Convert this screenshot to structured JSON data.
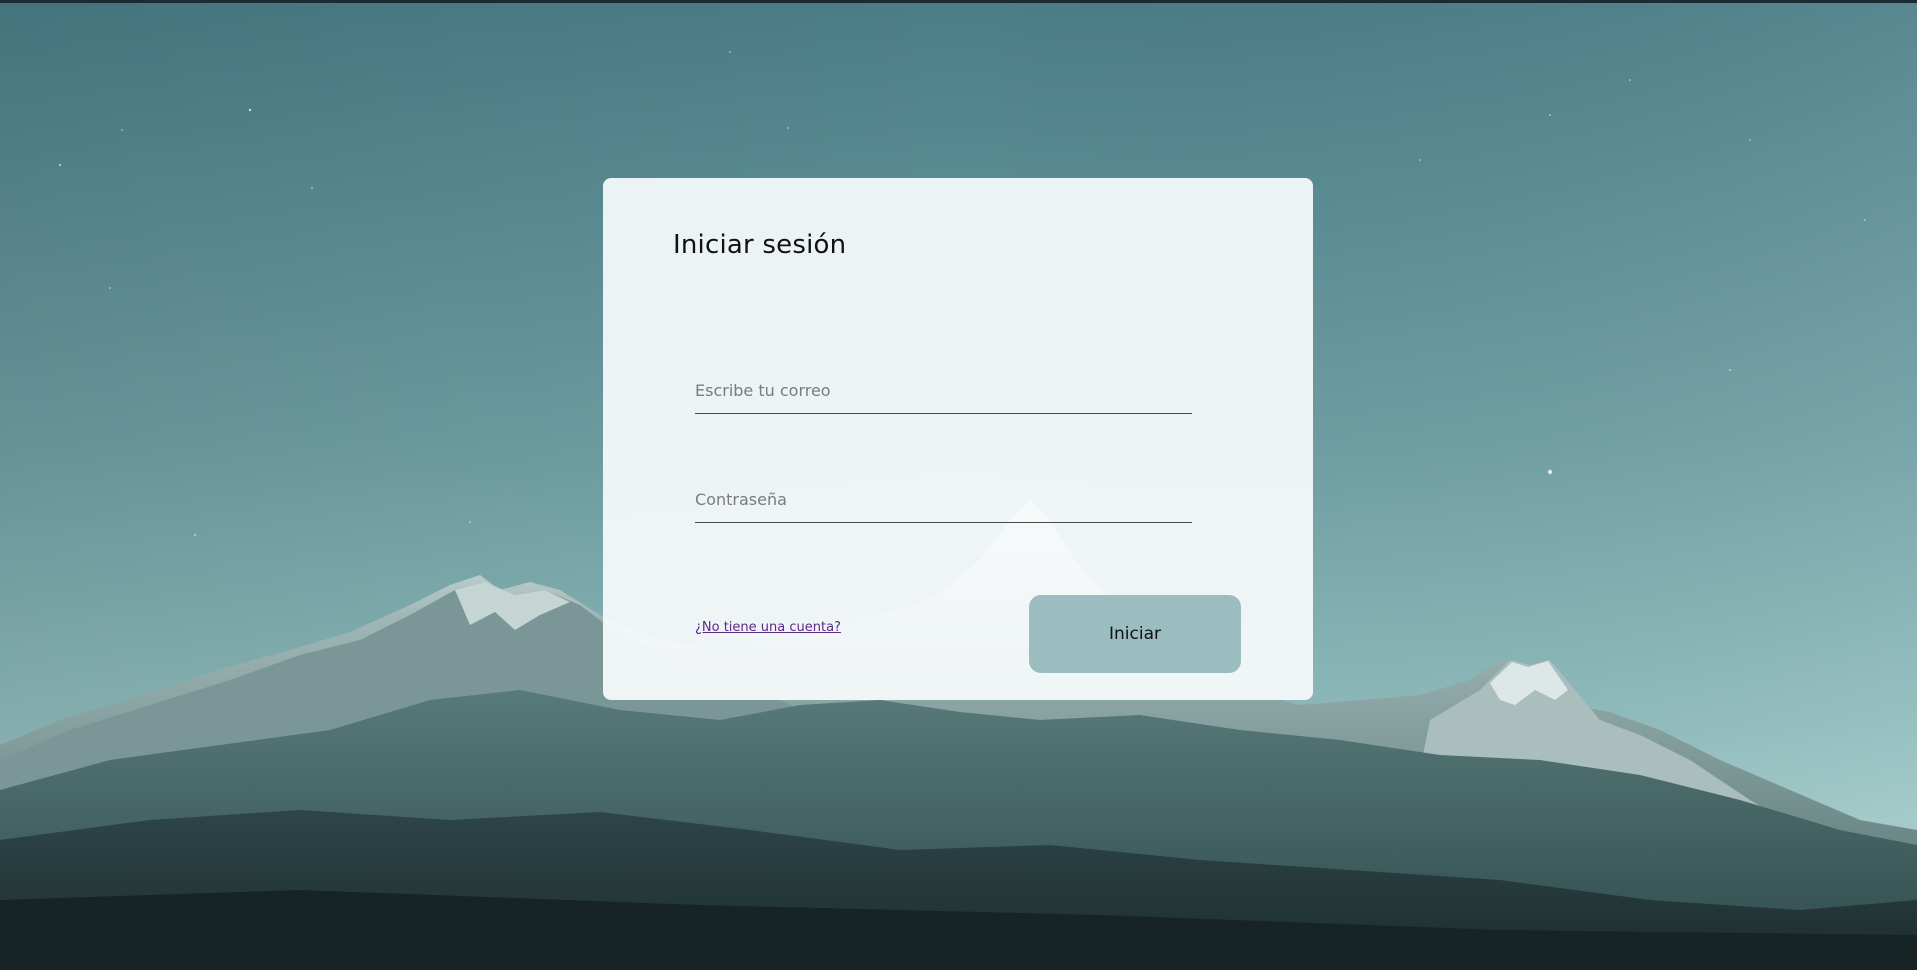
{
  "login": {
    "title": "Iniciar sesión",
    "email_placeholder": "Escribe tu correo",
    "email_value": "",
    "password_placeholder": "Contraseña",
    "password_value": "",
    "signup_link": "¿No tiene una cuenta?",
    "submit_label": "Iniciar"
  },
  "colors": {
    "card_background": "#f8fbfc",
    "button_background": "#9bbdbf",
    "link": "#5b2a86",
    "sky_top": "#4e8089",
    "sky_bottom": "#a6cfce"
  }
}
